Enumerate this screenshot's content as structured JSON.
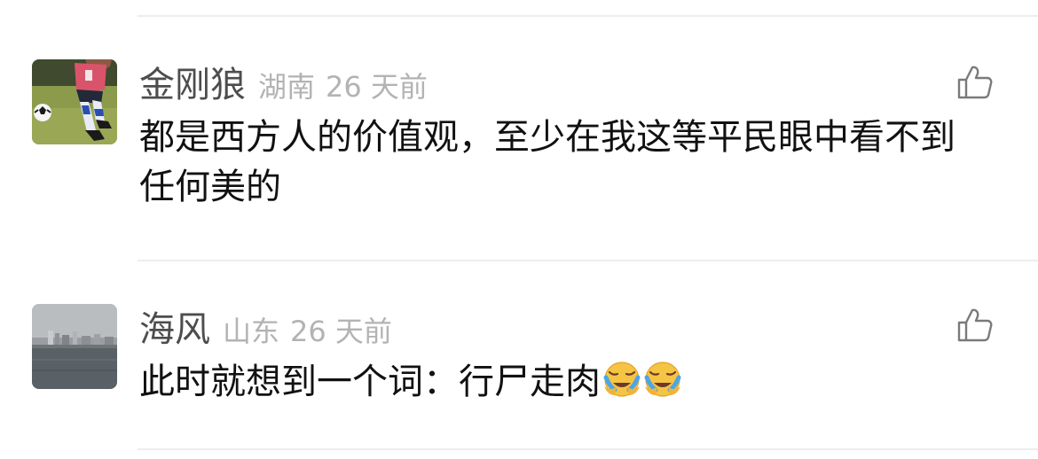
{
  "comments": [
    {
      "username": "金刚狼",
      "location": "湖南",
      "time": "26 天前",
      "text": "都是西方人的价值观，至少在我这等平民眼中看不到任何美的",
      "avatar_icon": "soccer-player-avatar",
      "like_icon": "thumbs-up-icon"
    },
    {
      "username": "海风",
      "location": "山东",
      "time": "26 天前",
      "text": "此时就想到一个词：行尸走肉",
      "emojis": [
        "crying-laughing-emoji",
        "crying-laughing-emoji"
      ],
      "avatar_icon": "seaside-city-avatar",
      "like_icon": "thumbs-up-icon"
    }
  ],
  "colors": {
    "username": "#4d4d4d",
    "meta": "#b3b3b3",
    "text": "#111111",
    "divider": "#ededed",
    "background": "#ffffff"
  }
}
